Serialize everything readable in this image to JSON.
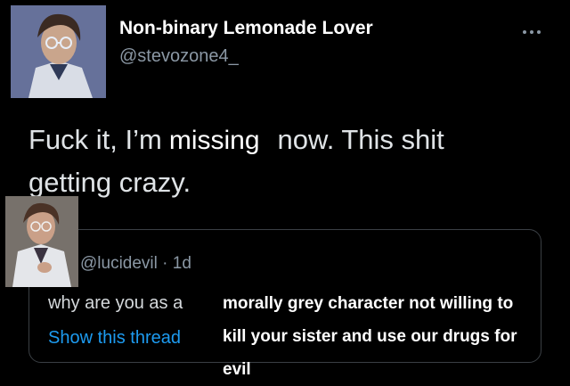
{
  "tweet": {
    "display_name": "Non-binary Lemonade Lover",
    "handle": "@stevozone4_",
    "text_before": "Fuck it, I’m",
    "text_after": "now. This shit getting crazy."
  },
  "more_menu": {
    "icon": "more-horizontal-icon"
  },
  "quote": {
    "author_line": "@lucidevil · 1d",
    "text_line": "why are you as a",
    "link": "Show this thread"
  },
  "captions": {
    "top": "missing",
    "bottom_lines": [
      "morally grey character not willing to",
      "kill your sister and use our drugs for",
      "evil"
    ]
  },
  "colors": {
    "background": "#000000",
    "link": "#1d9bf0",
    "muted": "#8b98a5"
  }
}
